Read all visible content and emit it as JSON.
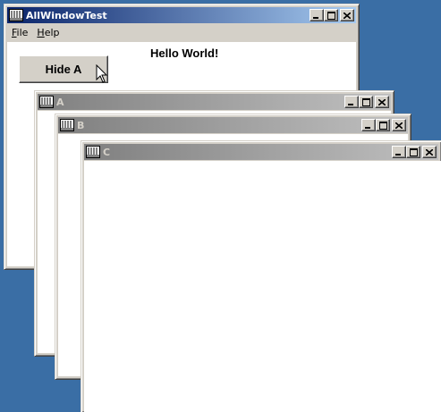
{
  "main_window": {
    "title": "AllWindowTest",
    "menu": [
      {
        "accel": "F",
        "rest": "ile"
      },
      {
        "accel": "H",
        "rest": "elp"
      }
    ],
    "button_label": "Hide A",
    "greeting": "Hello World!"
  },
  "child_windows": [
    {
      "title": "A"
    },
    {
      "title": "B"
    },
    {
      "title": "C"
    }
  ],
  "icons": {
    "app": "app-icon",
    "minimize": "minimize-icon",
    "maximize": "maximize-icon",
    "close": "close-icon",
    "cursor": "mouse-pointer-icon"
  },
  "colors": {
    "desktop": "#3a6ea5",
    "active_title_start": "#0a246a",
    "active_title_end": "#a6caf0",
    "inactive_title_start": "#808080",
    "inactive_title_end": "#c0c0c0",
    "window_face": "#d4d0c8"
  }
}
